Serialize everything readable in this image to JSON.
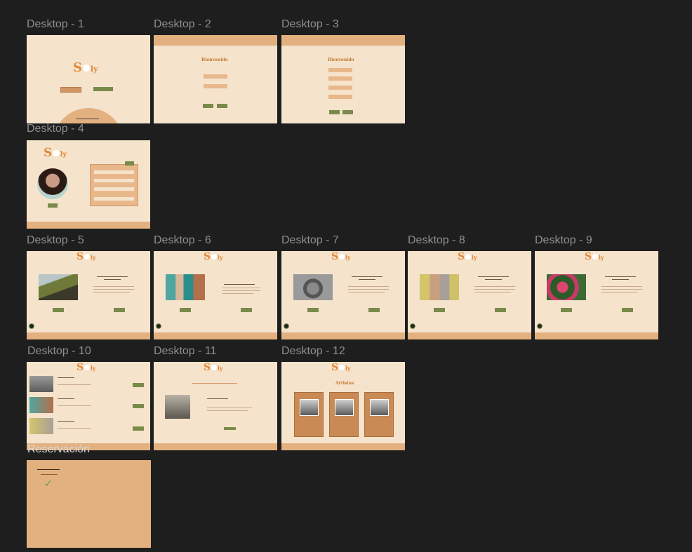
{
  "canvas": {
    "background": "#1e1e1e",
    "label_color": "#8f8f8f"
  },
  "frames": [
    {
      "id": "d1",
      "label": "Desktop - 1"
    },
    {
      "id": "d2",
      "label": "Desktop - 2"
    },
    {
      "id": "d3",
      "label": "Desktop - 3"
    },
    {
      "id": "d4",
      "label": "Desktop - 4"
    },
    {
      "id": "d5",
      "label": "Desktop - 5"
    },
    {
      "id": "d6",
      "label": "Desktop - 6"
    },
    {
      "id": "d7",
      "label": "Desktop - 7"
    },
    {
      "id": "d8",
      "label": "Desktop - 8"
    },
    {
      "id": "d9",
      "label": "Desktop - 9"
    },
    {
      "id": "d10",
      "label": "Desktop - 10"
    },
    {
      "id": "d11",
      "label": "Desktop - 11"
    },
    {
      "id": "d12",
      "label": "Desktop - 12"
    },
    {
      "id": "res",
      "label": "Reservación"
    }
  ],
  "colors": {
    "page": "#f5e3cc",
    "bar": "#e3b07f",
    "accent": "#e08a3c",
    "green": "#7a8a4a",
    "card": "#c98a55"
  },
  "texts": {
    "bienvenido": "Bienvenido",
    "artistas": "Artistas"
  },
  "icons": [
    "check-icon"
  ]
}
